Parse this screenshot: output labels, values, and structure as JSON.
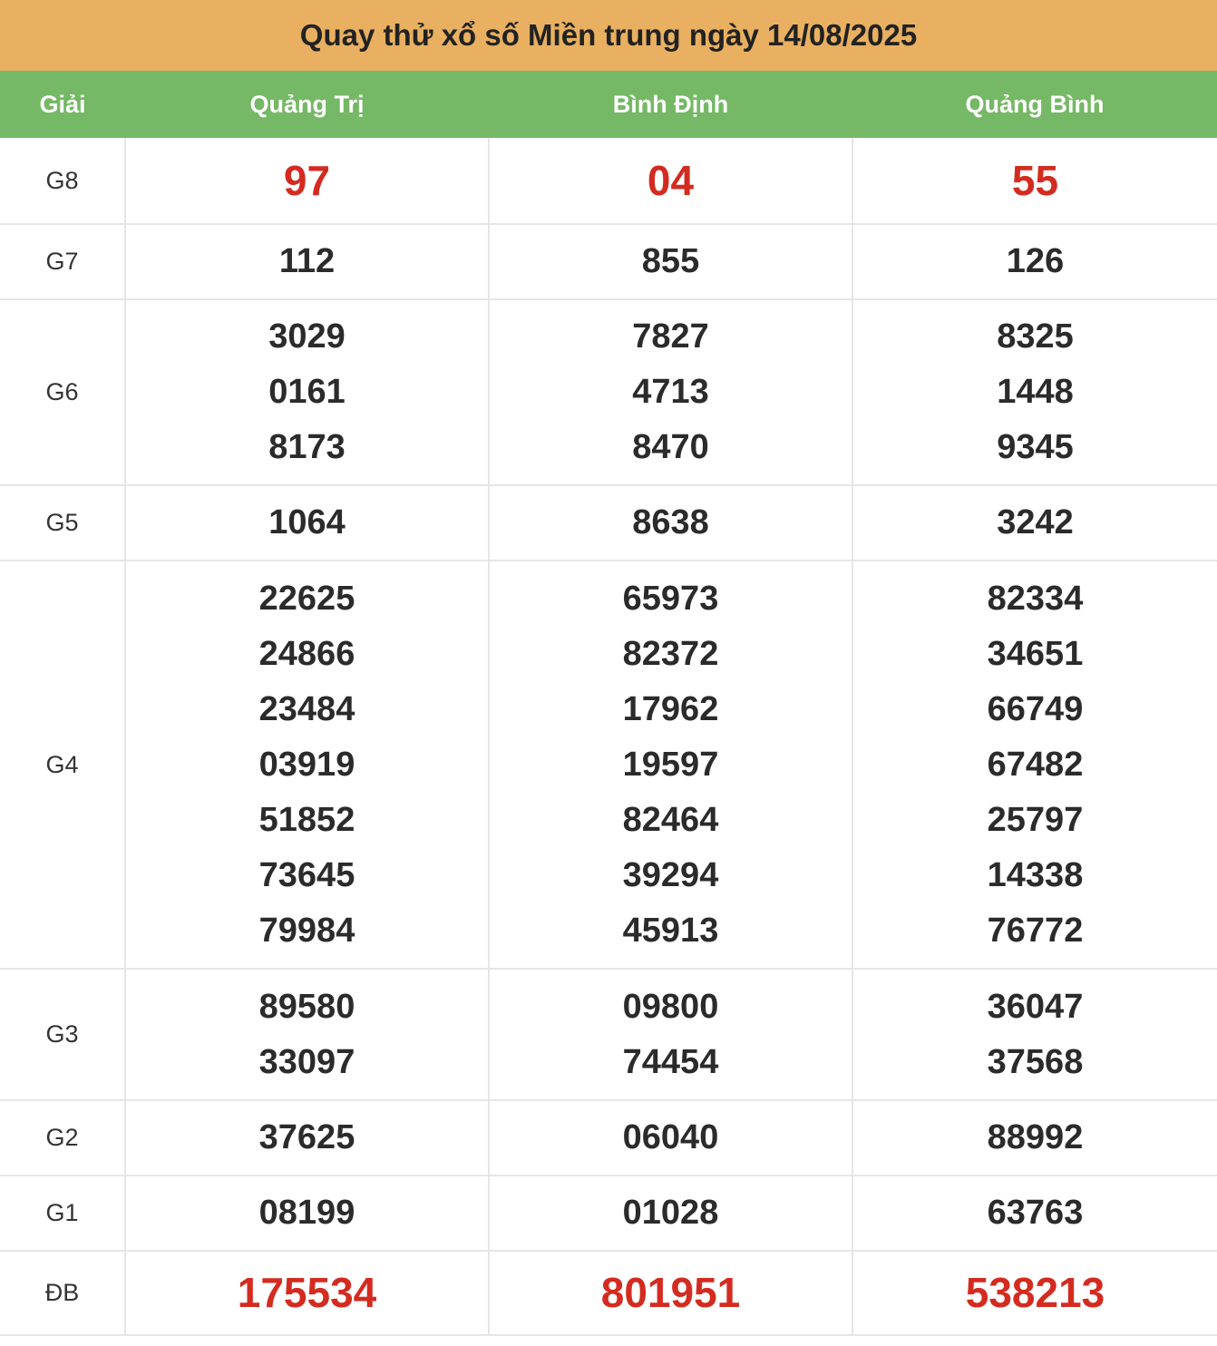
{
  "title": "Quay thử xổ số Miền trung ngày 14/08/2025",
  "columns": [
    "Giải",
    "Quảng Trị",
    "Bình Định",
    "Quảng Bình"
  ],
  "colors": {
    "title_bg": "#e8b060",
    "header_bg": "#75b865",
    "highlight": "#d42b20"
  },
  "rows": [
    {
      "prize": "G8",
      "values": [
        [
          "97"
        ],
        [
          "04"
        ],
        [
          "55"
        ]
      ]
    },
    {
      "prize": "G7",
      "values": [
        [
          "112"
        ],
        [
          "855"
        ],
        [
          "126"
        ]
      ]
    },
    {
      "prize": "G6",
      "values": [
        [
          "3029",
          "0161",
          "8173"
        ],
        [
          "7827",
          "4713",
          "8470"
        ],
        [
          "8325",
          "1448",
          "9345"
        ]
      ]
    },
    {
      "prize": "G5",
      "values": [
        [
          "1064"
        ],
        [
          "8638"
        ],
        [
          "3242"
        ]
      ]
    },
    {
      "prize": "G4",
      "values": [
        [
          "22625",
          "24866",
          "23484",
          "03919",
          "51852",
          "73645",
          "79984"
        ],
        [
          "65973",
          "82372",
          "17962",
          "19597",
          "82464",
          "39294",
          "45913"
        ],
        [
          "82334",
          "34651",
          "66749",
          "67482",
          "25797",
          "14338",
          "76772"
        ]
      ]
    },
    {
      "prize": "G3",
      "values": [
        [
          "89580",
          "33097"
        ],
        [
          "09800",
          "74454"
        ],
        [
          "36047",
          "37568"
        ]
      ]
    },
    {
      "prize": "G2",
      "values": [
        [
          "37625"
        ],
        [
          "06040"
        ],
        [
          "88992"
        ]
      ]
    },
    {
      "prize": "G1",
      "values": [
        [
          "08199"
        ],
        [
          "01028"
        ],
        [
          "63763"
        ]
      ]
    },
    {
      "prize": "ĐB",
      "values": [
        [
          "175534"
        ],
        [
          "801951"
        ],
        [
          "538213"
        ]
      ]
    }
  ]
}
